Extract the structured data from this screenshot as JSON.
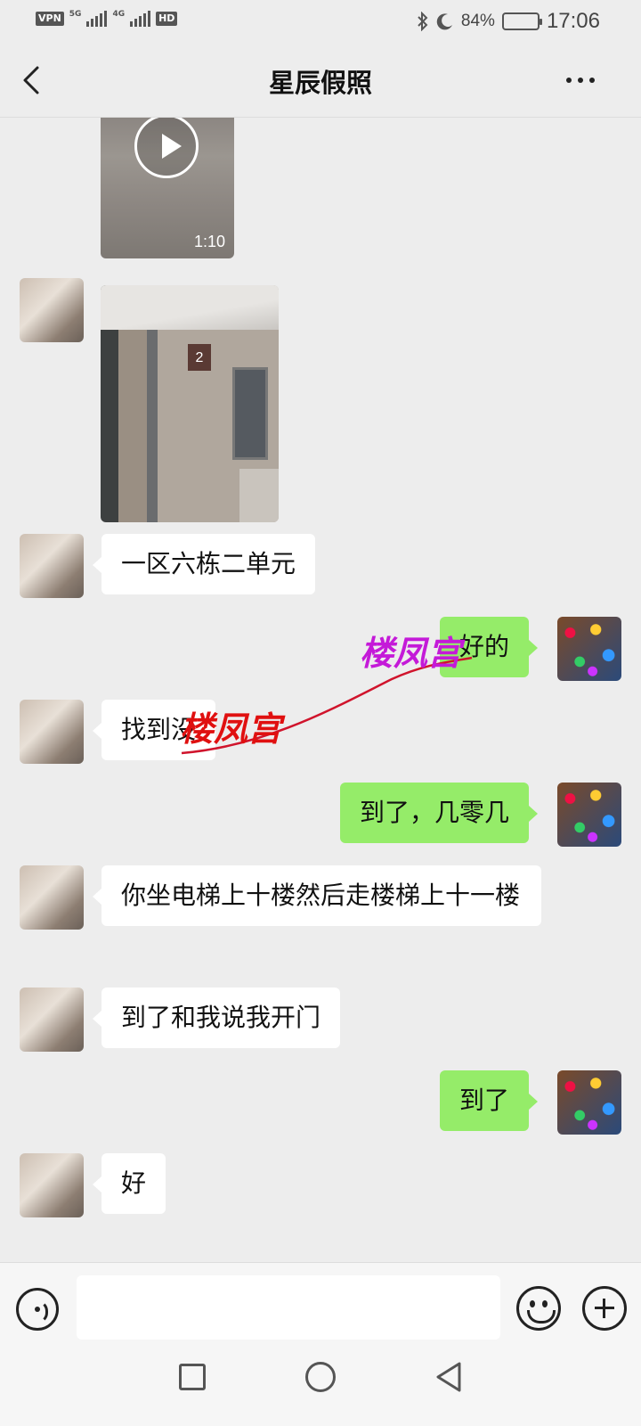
{
  "status_bar": {
    "vpn": "VPN",
    "net1": "5G",
    "net2": "4G",
    "hd": "HD",
    "battery_percent": "84%",
    "battery_level": 0.84,
    "time": "17:06"
  },
  "header": {
    "title": "星辰假照",
    "back_icon": "chevron-left-icon",
    "more_icon": "more-dots-icon"
  },
  "messages": [
    {
      "from": "her",
      "type": "video",
      "duration": "1:10"
    },
    {
      "from": "her",
      "type": "photo"
    },
    {
      "from": "her",
      "type": "text",
      "text": "一区六栋二单元"
    },
    {
      "from": "me",
      "type": "text",
      "text": "好的"
    },
    {
      "from": "her",
      "type": "text",
      "text": "找到没"
    },
    {
      "from": "me",
      "type": "text",
      "text": "到了，几零几"
    },
    {
      "from": "her",
      "type": "text",
      "text": "你坐电梯上十楼然后走楼梯上十一楼"
    },
    {
      "from": "her",
      "type": "text",
      "text": "到了和我说我开门"
    },
    {
      "from": "me",
      "type": "text",
      "text": "到了"
    },
    {
      "from": "her",
      "type": "text",
      "text": "好"
    }
  ],
  "photo_sign": "2",
  "watermark": {
    "text1": "楼凤宫",
    "text2": "楼凤宫",
    "color1": "#c41ad8",
    "color2": "#e01010"
  },
  "input_bar": {
    "voice_icon": "voice-icon",
    "emoji_icon": "emoji-icon",
    "plus_icon": "plus-icon"
  },
  "colors": {
    "out_bubble": "#95ec69",
    "in_bubble": "#ffffff",
    "background": "#ededed"
  }
}
